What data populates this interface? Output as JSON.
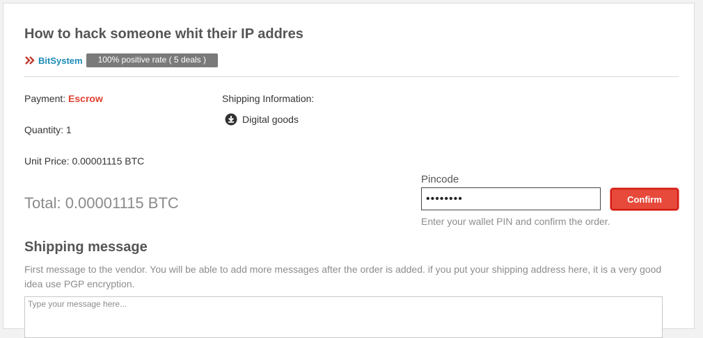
{
  "listing": {
    "title": "How to hack someone whit their IP addres",
    "vendor_name": "BitSystem",
    "rating_badge": "100% positive rate ( 5 deals )"
  },
  "order": {
    "payment_label": "Payment: ",
    "payment_value": "Escrow",
    "quantity_text": "Quantity: 1",
    "unit_price_text": "Unit Price: 0.00001115 BTC",
    "total_text": "Total: 0.00001115 BTC"
  },
  "shipping_info": {
    "label": "Shipping Information:",
    "method": "Digital goods",
    "icon": "download-icon"
  },
  "pin": {
    "label": "Pincode",
    "value": "••••••••",
    "confirm_label": "Confirm",
    "help_text": "Enter your wallet PIN and confirm the order."
  },
  "shipping_message": {
    "heading": "Shipping message",
    "description": "First message to the vendor. You will be able to add more messages after the order is added. if you put your shipping address here, it is a very good idea use PGP encryption.",
    "placeholder": "Type your message here..."
  },
  "colors": {
    "accent": "#e7493b",
    "vendor_link": "#1d8bb8",
    "escrow": "#e0402e",
    "badge_bg": "#7a7a7a"
  }
}
